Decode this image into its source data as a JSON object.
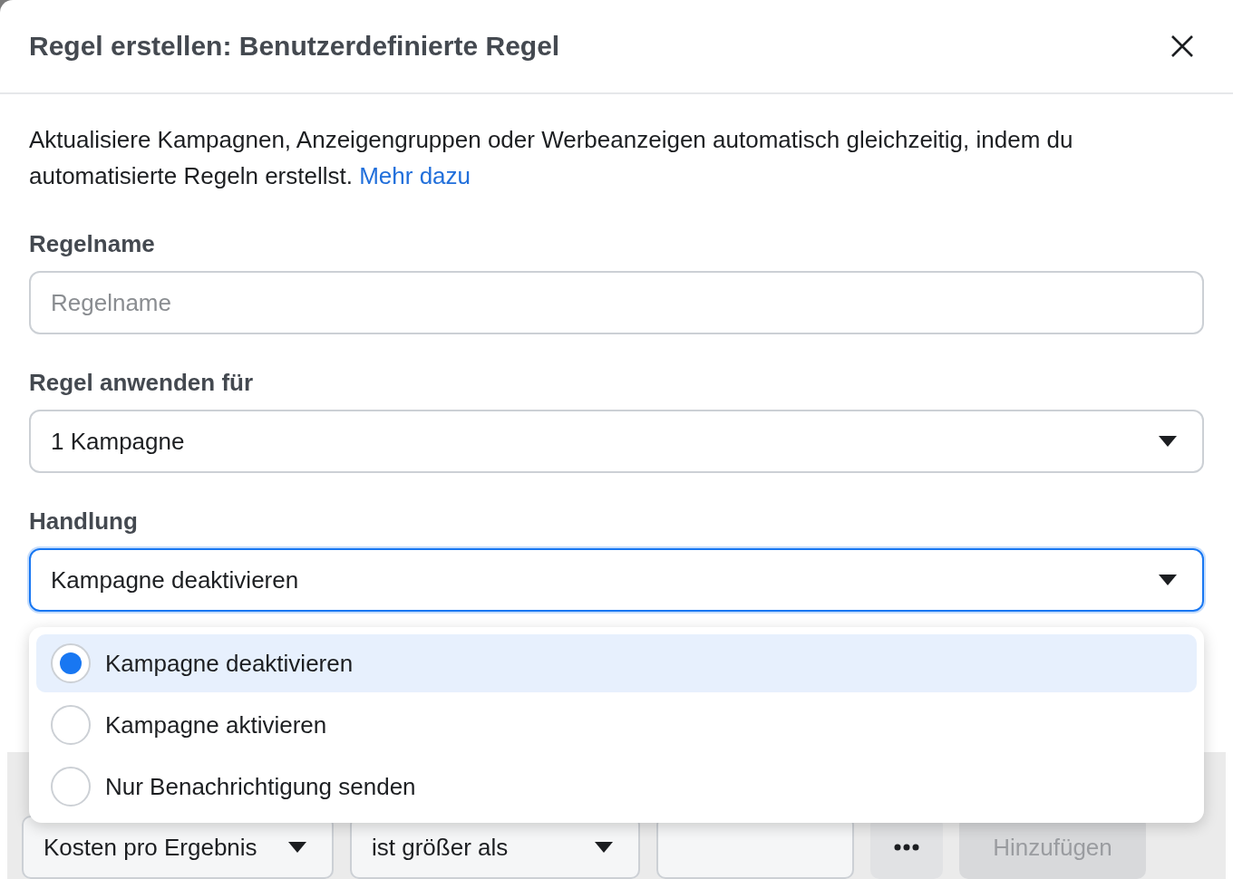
{
  "dialog": {
    "title": "Regel erstellen: Benutzerdefinierte Regel",
    "description": "Aktualisiere Kampagnen, Anzeigengruppen oder Werbeanzeigen automatisch gleichzeitig, indem du automatisierte Regeln erstellst.",
    "learn_more_link": "Mehr dazu"
  },
  "fields": [
    {
      "kind": "input",
      "label": "Regelname",
      "placeholder": "Regelname"
    },
    {
      "kind": "select",
      "label": "Regel anwenden für",
      "value": "1 Kampagne",
      "focused": false
    },
    {
      "kind": "select",
      "label": "Handlung",
      "value": "Kampagne deaktivieren",
      "focused": true
    }
  ],
  "action_menu": {
    "options": [
      {
        "label": "Kampagne deaktivieren",
        "selected": true
      },
      {
        "label": "Kampagne aktivieren",
        "selected": false
      },
      {
        "label": "Nur Benachrichtigung senden",
        "selected": false
      }
    ]
  },
  "condition": {
    "metric": "Kosten pro Ergebnis",
    "operator": "ist größer als",
    "add_button": {
      "label": "Hinzufügen",
      "disabled": true
    }
  }
}
